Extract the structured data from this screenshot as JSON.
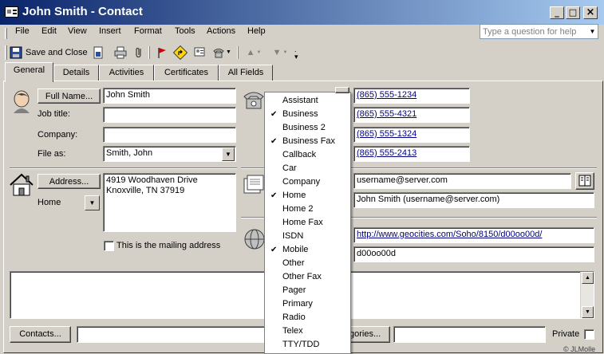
{
  "window": {
    "title": "John Smith - Contact",
    "minimize": "_",
    "maximize": "□",
    "close": "×"
  },
  "menu": {
    "items": [
      "File",
      "Edit",
      "View",
      "Insert",
      "Format",
      "Tools",
      "Actions",
      "Help"
    ],
    "help_placeholder": "Type a question for help"
  },
  "toolbar": {
    "save_close": "Save and Close"
  },
  "tabs": [
    "General",
    "Details",
    "Activities",
    "Certificates",
    "All Fields"
  ],
  "general": {
    "full_name_button": "Full Name...",
    "full_name_value": "John Smith",
    "job_title_label": "Job title:",
    "job_title_value": "",
    "company_label": "Company:",
    "company_value": "",
    "file_as_label": "File as:",
    "file_as_value": "Smith, John",
    "address_button": "Address...",
    "address_type": "Home",
    "address_line1": "4919 Woodhaven Drive",
    "address_line2": "Knoxville, TN  37919",
    "mailing_label": "This is the mailing address"
  },
  "phones": [
    "(865) 555-1234",
    "(865) 555-4321",
    "(865) 555-1324",
    "(865) 555-2413"
  ],
  "email": {
    "address": "username@server.com",
    "display_as": "John Smith (username@server.com)"
  },
  "web": {
    "url": "http://www.geocities.com/Soho/8150/d00oo00d/",
    "im": "d00oo00d"
  },
  "footer": {
    "contacts_button": "Contacts...",
    "categories_button_visible": "gories...",
    "private_label": "Private",
    "watermark": "© JLMolle"
  },
  "dropdown": {
    "items": [
      {
        "label": "Assistant",
        "checked": false
      },
      {
        "label": "Business",
        "checked": true
      },
      {
        "label": "Business 2",
        "checked": false
      },
      {
        "label": "Business Fax",
        "checked": true
      },
      {
        "label": "Callback",
        "checked": false
      },
      {
        "label": "Car",
        "checked": false
      },
      {
        "label": "Company",
        "checked": false
      },
      {
        "label": "Home",
        "checked": true
      },
      {
        "label": "Home 2",
        "checked": false
      },
      {
        "label": "Home Fax",
        "checked": false
      },
      {
        "label": "ISDN",
        "checked": false
      },
      {
        "label": "Mobile",
        "checked": true
      },
      {
        "label": "Other",
        "checked": false
      },
      {
        "label": "Other Fax",
        "checked": false
      },
      {
        "label": "Pager",
        "checked": false
      },
      {
        "label": "Primary",
        "checked": false
      },
      {
        "label": "Radio",
        "checked": false
      },
      {
        "label": "Telex",
        "checked": false
      },
      {
        "label": "TTY/TDD",
        "checked": false
      }
    ]
  }
}
